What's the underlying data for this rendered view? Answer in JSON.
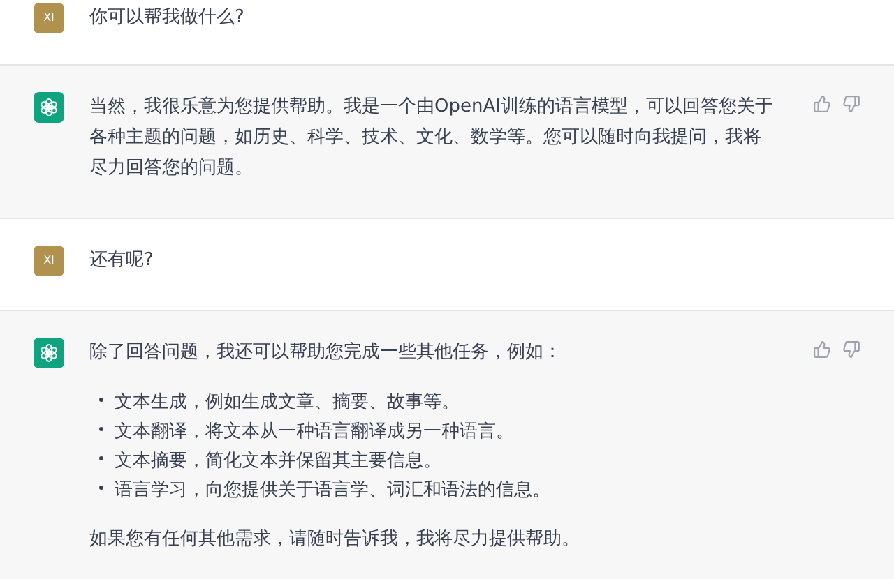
{
  "messages": [
    {
      "kind": "user",
      "avatar": "XI",
      "blocks": [
        {
          "kind": "paragraph",
          "text": "你可以帮我做什么?"
        }
      ]
    },
    {
      "kind": "assistant",
      "blocks": [
        {
          "kind": "paragraph",
          "text": "当然，我很乐意为您提供帮助。我是一个由OpenAI训练的语言模型，可以回答您关于各种主题的问题，如历史、科学、技术、文化、数学等。您可以随时向我提问，我将尽力回答您的问题。"
        }
      ]
    },
    {
      "kind": "user",
      "avatar": "XI",
      "blocks": [
        {
          "kind": "paragraph",
          "text": "还有呢?"
        }
      ]
    },
    {
      "kind": "assistant",
      "blocks": [
        {
          "kind": "paragraph",
          "text": "除了回答问题，我还可以帮助您完成一些其他任务，例如："
        },
        {
          "kind": "list",
          "items": [
            "文本生成，例如生成文章、摘要、故事等。",
            "文本翻译，将文本从一种语言翻译成另一种语言。",
            "文本摘要，简化文本并保留其主要信息。",
            "语言学习，向您提供关于语言学、词汇和语法的信息。"
          ]
        },
        {
          "kind": "paragraph",
          "text": "如果您有任何其他需求，请随时告诉我，我将尽力提供帮助。"
        }
      ]
    }
  ]
}
